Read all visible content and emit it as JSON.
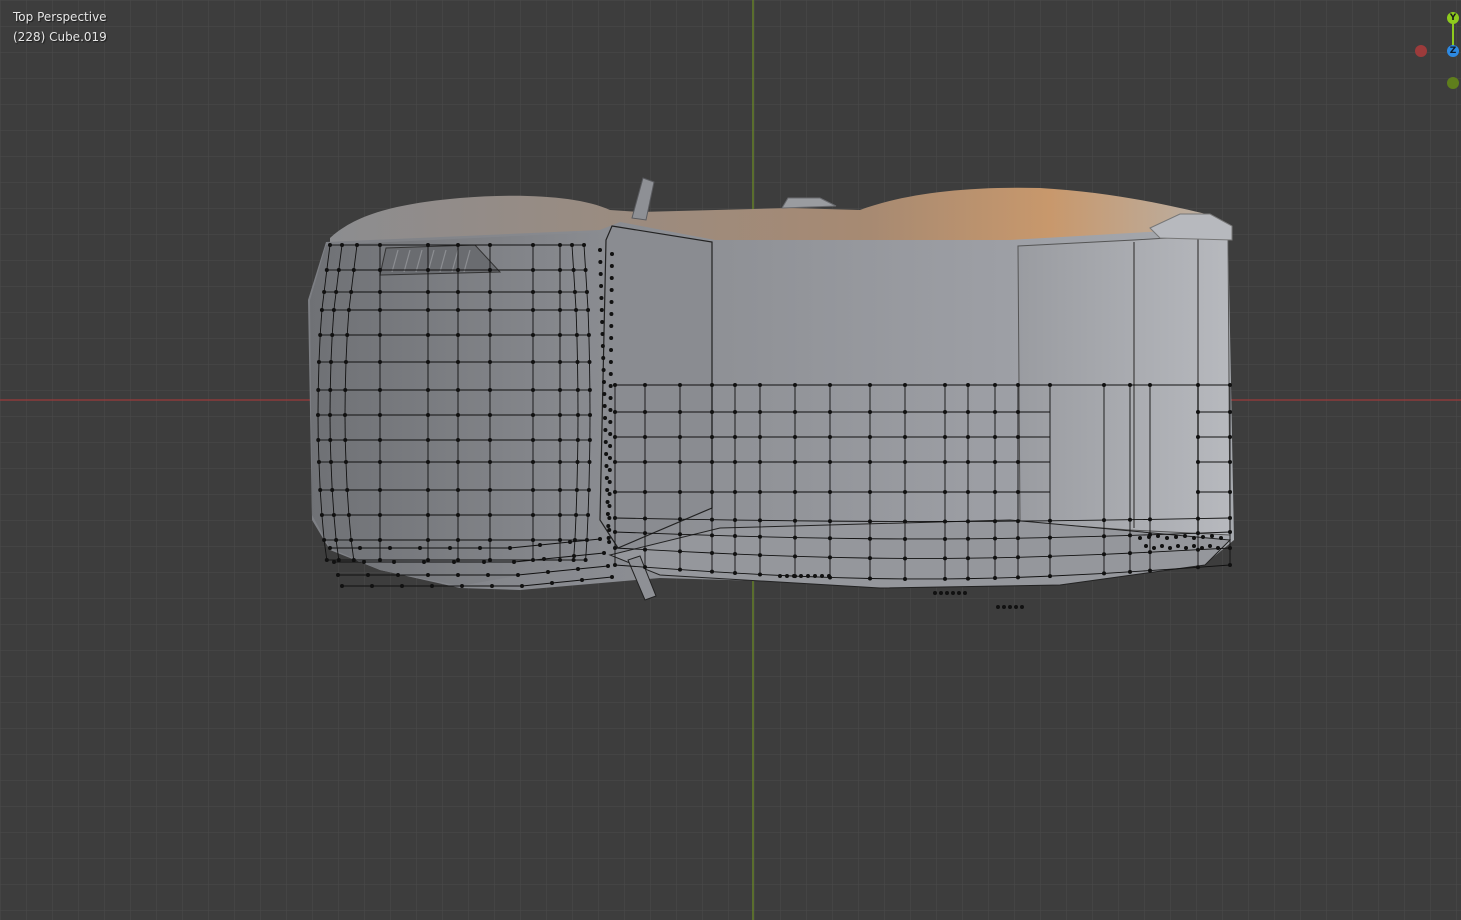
{
  "viewport": {
    "view_name": "Top Perspective",
    "object_info": "(228) Cube.019",
    "background_color": "#3d3d3d",
    "grid_color": "#4a4a4a",
    "axis_x_color": "#a33b3b",
    "axis_y_color": "#7a9a2a"
  },
  "gizmo": {
    "y_label": "Y",
    "z_label": "Z",
    "y_color": "#8ecb1d",
    "z_color": "#2d8ae3",
    "x_neg_color": "#9c3b3b",
    "y_neg_color": "#5f7e1c"
  },
  "model": {
    "name": "Cube.019",
    "body_color": "#a9abb0",
    "highlight_color": "#c9a47e",
    "wire_color": "#111111"
  }
}
